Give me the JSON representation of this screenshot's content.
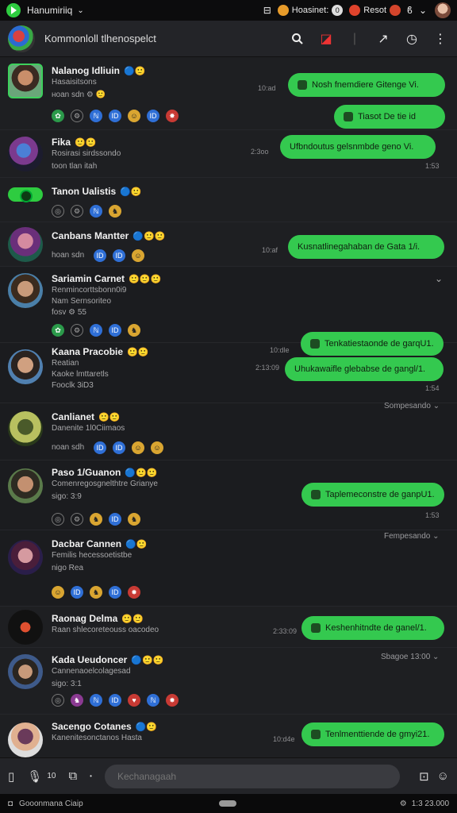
{
  "status_bar": {
    "app_name": "Hanumiriiq",
    "chip1": "Hoasinet:",
    "chip1_badge": "0",
    "chip2": "Resot"
  },
  "header": {
    "title": "Kommonloll tlhenospelct"
  },
  "rows": [
    {
      "name": "Nalanog Idliuin",
      "emoji": "🔵🙂",
      "sub1": "Hasaisitsons",
      "sub2": "ноan sdn ⚙ 🙂",
      "bubble": "Nosh fnemdiere Gitenge Vi.",
      "time": "10:ad",
      "bubble2": "Tiasot De tie id"
    },
    {
      "name": "Fika",
      "emoji": "🙂🙂",
      "sub1": "Rosirasi sirdssondo",
      "sub2": "toon tlan itah",
      "bubble": "Ufbndoutus gelsnmbde geno Vi.",
      "time": "2:3oo",
      "time2": "1:53"
    },
    {
      "name": "Tanon Ualistis",
      "emoji": "🔵🙂"
    },
    {
      "name": "Canbans Mantter",
      "emoji": "🔵🙂🙂",
      "sub1": "hoan sdn",
      "bubble": "Kusnatlinegahaban de Gata 1/i.",
      "time": "10:af"
    },
    {
      "name": "Sariamin Carnet",
      "emoji": "🙂🙂🙂",
      "sub1": "Renmincorttsbonn0i9",
      "sub2": "Nam Sernsoriteo",
      "sub3": "fosv  ⚙ 55"
    },
    {
      "name": "Kaana Pracobie",
      "emoji": "🙂🙂",
      "sub1": "Reatian",
      "sub2": "Kaoke lmttaretls",
      "sub3": "Fooclk 3iD3",
      "bubble": "Tenkatiestaonde de garqU1.",
      "time": "10:dle",
      "bubble2": "Uhukawaifle glebabse de gangl/1.",
      "time2": "2:13:09",
      "time3": "1:54"
    },
    {
      "name": "Canlianet",
      "emoji": "🙂🙂",
      "sub1": "Danenite 1l0Ciimaos",
      "sub2": "noan sdh",
      "status": "Sompesando"
    },
    {
      "name": "Paso 1/Guanon",
      "emoji": "🔵🙂🙂",
      "sub1": "Comenregosgnelthtre Grianye",
      "sub2": "sigo: 3:9",
      "bubble": "Taplemeconstre de ganpU1.",
      "time": "1:53"
    },
    {
      "name": "Dacbar Cannen",
      "emoji": "🔵🙂",
      "sub1": "Femilis hecessoetistbe",
      "sub2": "nigo  Rea",
      "status": "Fempesando"
    },
    {
      "name": "Raonag Delma",
      "emoji": "🙂🙂",
      "sub1": "Raan shlecoreteouss oacodeo",
      "bubble": "Keshenhitndte de ganel/1.",
      "time": "2:33:09"
    },
    {
      "name": "Kada Ueudoncer",
      "emoji": "🔵🙂🙂",
      "sub1": "Cannenaoelcolagesad",
      "sub2": "sigo: 3:1",
      "status": "Sbagoe 13:00",
      "status2": "Sbagoe 13:0ie"
    },
    {
      "name": "Sacengo Cotanes",
      "emoji": "🔵🙂",
      "sub1": "Kanenitesonctanos Hasta",
      "bubble": "Tenlmenttiende de gmyi21.",
      "time": "10:d4e"
    }
  ],
  "composer": {
    "placeholder": "Kechanagaah",
    "left_count": "10"
  },
  "nav": {
    "left": "Gooonmana  Ciaip",
    "right": "1:3 23.000"
  }
}
